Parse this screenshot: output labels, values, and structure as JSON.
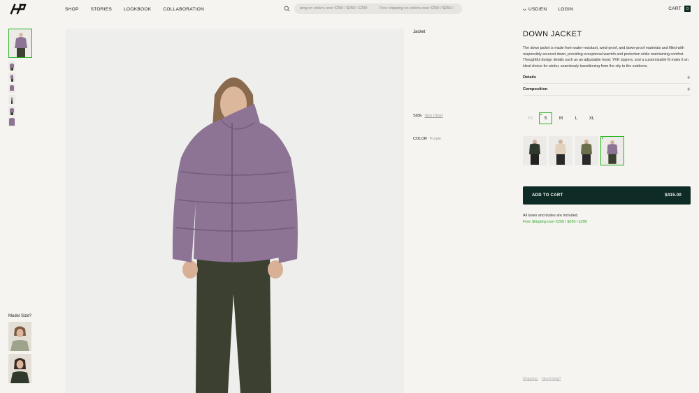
{
  "header": {
    "logo_text": "HP",
    "nav": [
      "SHOP",
      "STORIES",
      "LOOKBOOK",
      "COLLABORATION"
    ],
    "ticker": [
      "ping on orders over €250 / $250 / £200",
      "Free shipping on orders over €250 / $250 /"
    ],
    "currency": "USD/EN",
    "login": "LOGIN",
    "cart_label": "CART",
    "cart_count": "0"
  },
  "sidebar": {
    "model_size_label": "Model Size?"
  },
  "product": {
    "type": "Jacket",
    "title": "DOWN JACKET",
    "description": "The down jacket is made from water-resistant, wind-proof, and down-proof materials and filled with responsibly sourced down, providing exceptional warmth and protection while maintaining comfort. Thoughtful design details such as an adjustable hood, YKK zippers, and a customizable fit make it an ideal choice for winter, seamlessly transitioning from the city to the outdoors.",
    "accordions": [
      "Details",
      "Composition"
    ],
    "size_label": "SIZE",
    "size_chart_label": "Size Chart",
    "color_label": "COLOR",
    "color_value": "Purple",
    "sizes": [
      "XS",
      "S",
      "M",
      "L",
      "XL"
    ],
    "selected_size": "S",
    "add_to_cart": "ADD TO CART",
    "price": "$415.00",
    "tax_note": "All taxes and duties are included.",
    "shipping_note": "Free Shipping over €250 / $250 / £200",
    "footer_links": [
      "Shipping",
      "Need help?"
    ]
  },
  "colors": {
    "accent": "#27b41e",
    "button": "#0e2b25",
    "jacket_purple": "#8d7394",
    "pants_green": "#3b4030"
  }
}
